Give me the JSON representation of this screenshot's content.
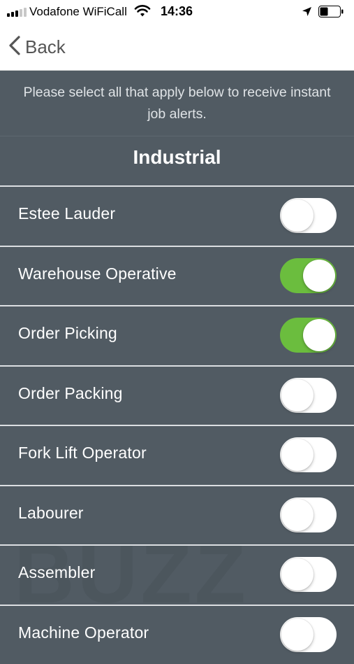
{
  "status_bar": {
    "carrier": "Vodafone WiFiCall",
    "time": "14:36",
    "signal_bars_on": 3,
    "signal_bars_total": 5,
    "icons": [
      "signal-icon",
      "wifi-icon",
      "location-arrow-icon",
      "battery-icon"
    ]
  },
  "nav": {
    "back_label": "Back",
    "back_icon": "chevron-left-icon"
  },
  "intro_text": "Please select all that apply below to receive instant job alerts.",
  "section_title": "Industrial",
  "watermark": "BUZZ",
  "colors": {
    "background": "#515b63",
    "toggle_on": "#6bbd3e",
    "toggle_off": "#ffffff"
  },
  "items": [
    {
      "label": "Estee Lauder",
      "on": false
    },
    {
      "label": "Warehouse Operative",
      "on": true
    },
    {
      "label": "Order Picking",
      "on": true
    },
    {
      "label": "Order Packing",
      "on": false
    },
    {
      "label": "Fork Lift Operator",
      "on": false
    },
    {
      "label": "Labourer",
      "on": false
    },
    {
      "label": "Assembler",
      "on": false
    },
    {
      "label": "Machine Operator",
      "on": false
    }
  ]
}
